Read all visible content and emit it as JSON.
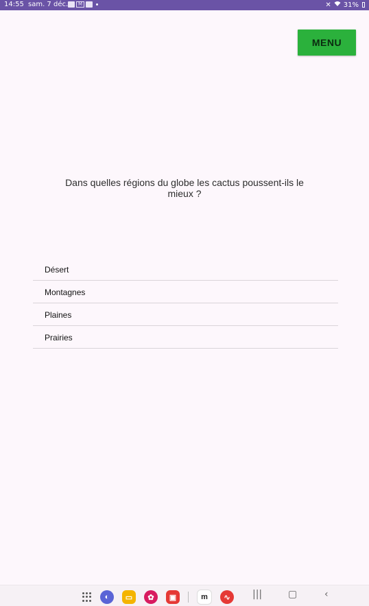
{
  "status_bar": {
    "time": "14:55",
    "date": "sam. 7 déc.",
    "battery": "31%"
  },
  "menu": {
    "label": "MENU"
  },
  "quiz": {
    "question": "Dans quelles régions du globe les cactus poussent-ils le mieux ?",
    "answers": [
      "Désert",
      "Montagnes",
      "Plaines",
      "Prairies"
    ]
  },
  "colors": {
    "status_bar": "#6a53a6",
    "menu_button": "#2bb13c",
    "background": "#fdf7fc"
  },
  "dock": {
    "apps": [
      "apps-grid-icon",
      "internet-icon",
      "files-icon",
      "gallery-icon",
      "notes-icon",
      "m-app-icon",
      "recorder-icon"
    ]
  }
}
